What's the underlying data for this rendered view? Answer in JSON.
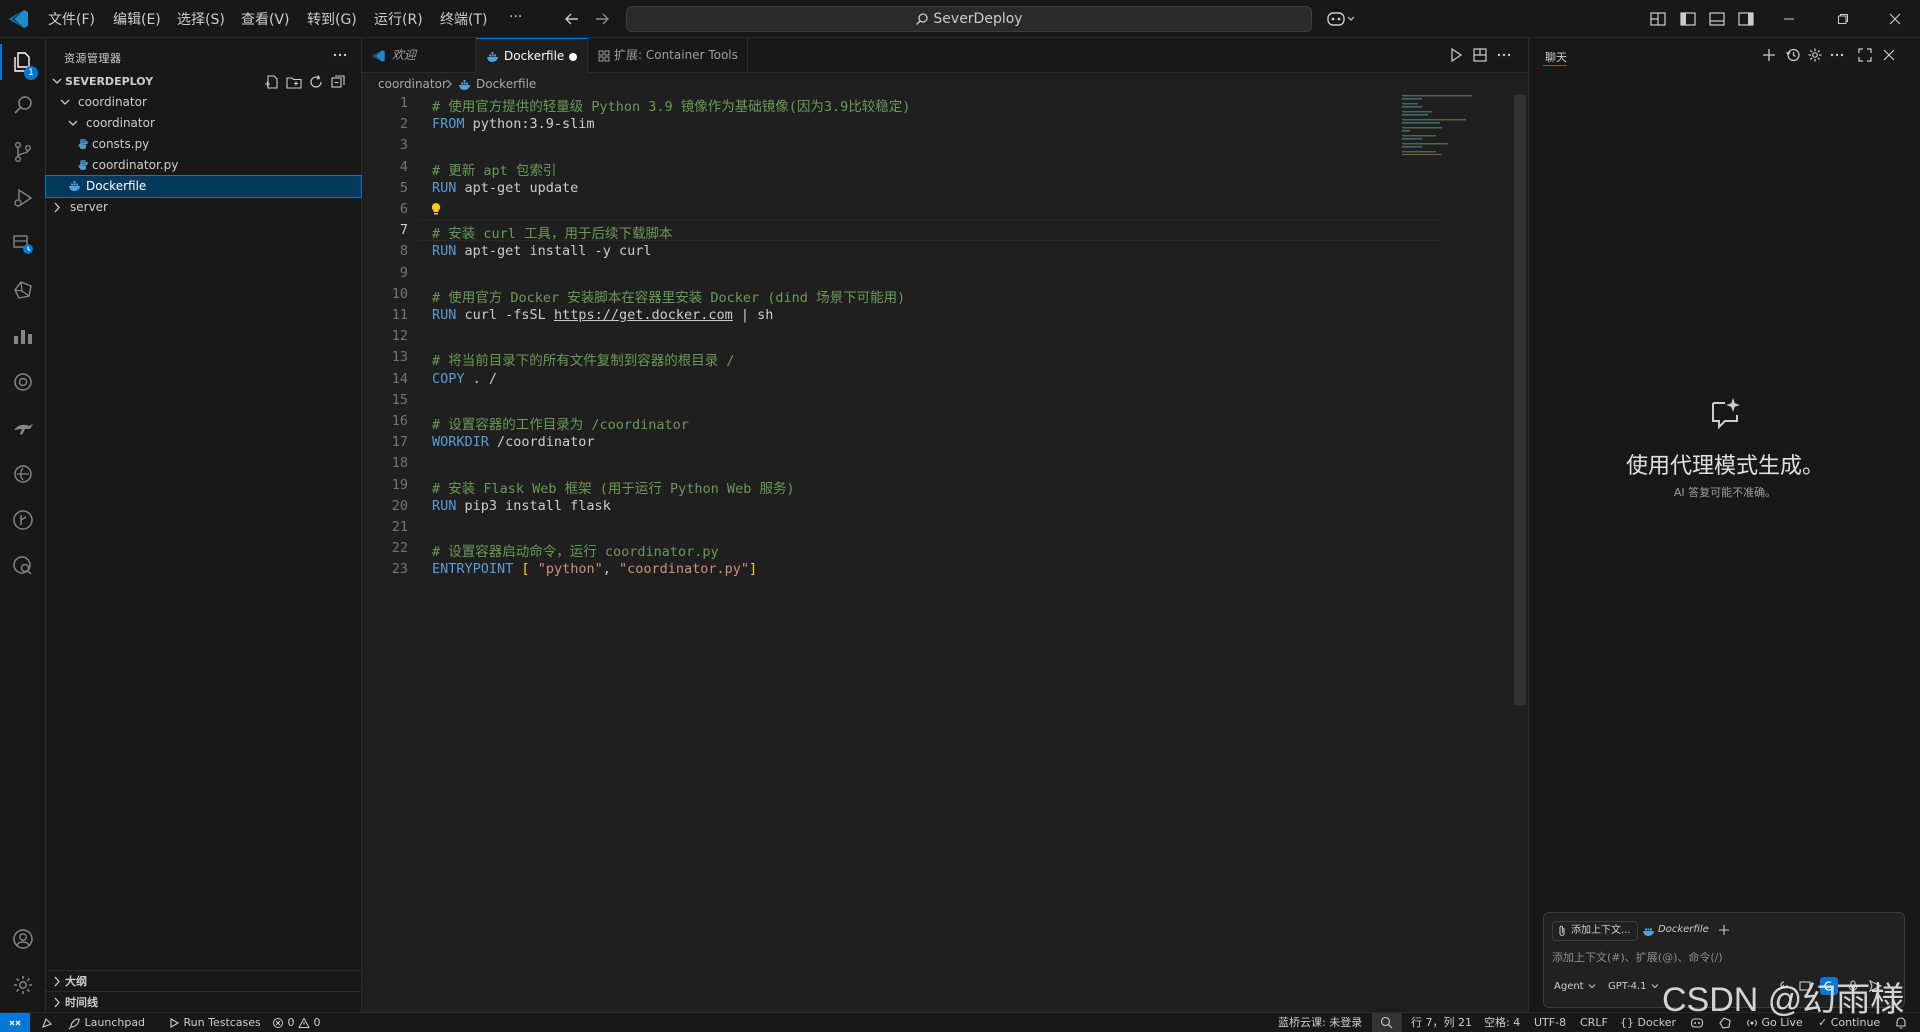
{
  "titlebar": {
    "menu": [
      "文件(F)",
      "编辑(E)",
      "选择(S)",
      "查看(V)",
      "转到(G)",
      "运行(R)",
      "终端(T)",
      "···"
    ],
    "search_text": "SeverDeploy"
  },
  "activity": {
    "explorer_badge": "1"
  },
  "sidebar": {
    "title": "资源管理器",
    "root": "SEVERDEPLOY",
    "items": [
      {
        "label": "coordinator"
      },
      {
        "label": "coordinator"
      },
      {
        "label": "consts.py"
      },
      {
        "label": "coordinator.py"
      },
      {
        "label": "Dockerfile"
      },
      {
        "label": "server"
      }
    ],
    "outline": "大纲",
    "timeline": "时间线"
  },
  "tabs": [
    {
      "label": "欢迎"
    },
    {
      "label": "Dockerfile"
    },
    {
      "label": "扩展: Container Tools"
    }
  ],
  "breadcrumb": [
    "coordinator",
    "Dockerfile"
  ],
  "editor": {
    "current_line": 7,
    "lines": [
      [
        {
          "t": "c",
          "v": "# 使用官方提供的轻量级 Python 3.9 镜像作为基础镜像(因为3.9比较稳定)"
        }
      ],
      [
        {
          "t": "k",
          "v": "FROM"
        },
        {
          "t": "p",
          "v": " python:3.9-slim"
        }
      ],
      [],
      [
        {
          "t": "c",
          "v": "# 更新 apt 包索引"
        }
      ],
      [
        {
          "t": "k",
          "v": "RUN"
        },
        {
          "t": "p",
          "v": " apt-get update"
        }
      ],
      [],
      [
        {
          "t": "c",
          "v": "# 安装 curl 工具，用于后续下载脚本"
        }
      ],
      [
        {
          "t": "k",
          "v": "RUN"
        },
        {
          "t": "p",
          "v": " apt-get install -y curl"
        }
      ],
      [],
      [
        {
          "t": "c",
          "v": "# 使用官方 Docker 安装脚本在容器里安装 Docker (dind 场景下可能用)"
        }
      ],
      [
        {
          "t": "k",
          "v": "RUN"
        },
        {
          "t": "p",
          "v": " curl -fsSL "
        },
        {
          "t": "l",
          "v": "https://get.docker.com"
        },
        {
          "t": "p",
          "v": " | sh"
        }
      ],
      [],
      [
        {
          "t": "c",
          "v": "# 将当前目录下的所有文件复制到容器的根目录 /"
        }
      ],
      [
        {
          "t": "k",
          "v": "COPY"
        },
        {
          "t": "p",
          "v": " . /"
        }
      ],
      [],
      [
        {
          "t": "c",
          "v": "# 设置容器的工作目录为 /coordinator"
        }
      ],
      [
        {
          "t": "k",
          "v": "WORKDIR"
        },
        {
          "t": "p",
          "v": " /coordinator"
        }
      ],
      [],
      [
        {
          "t": "c",
          "v": "# 安装 Flask Web 框架 (用于运行 Python Web 服务)"
        }
      ],
      [
        {
          "t": "k",
          "v": "RUN"
        },
        {
          "t": "p",
          "v": " pip3 install flask"
        }
      ],
      [],
      [
        {
          "t": "c",
          "v": "# 设置容器启动命令，运行 coordinator.py"
        }
      ],
      [
        {
          "t": "k",
          "v": "ENTRYPOINT"
        },
        {
          "t": "p",
          "v": " "
        },
        {
          "t": "b",
          "v": "["
        },
        {
          "t": "p",
          "v": " "
        },
        {
          "t": "s",
          "v": "\"python\""
        },
        {
          "t": "p",
          "v": ", "
        },
        {
          "t": "s",
          "v": "\"coordinator.py\""
        },
        {
          "t": "b",
          "v": "]"
        }
      ]
    ]
  },
  "chat": {
    "title": "聊天",
    "heading": "使用代理模式生成。",
    "subheading": "AI 答复可能不准确。",
    "add_context": "添加上下文...",
    "context_file": "Dockerfile",
    "placeholder": "添加上下文(#)、扩展(@)、命令(/)",
    "mode": "Agent",
    "model": "GPT-4.1"
  },
  "status": {
    "launchpad": "Launchpad",
    "run_testcases": "Run Testcases",
    "errors": "0",
    "warnings": "0",
    "cloud": "蓝桥云课: 未登录",
    "position": "行 7，列 21",
    "spaces": "空格: 4",
    "encoding": "UTF-8",
    "eol": "CRLF",
    "language": "Docker",
    "golive": "Go Live",
    "continue": "Continue"
  },
  "watermark": "CSDN @幻雨様"
}
